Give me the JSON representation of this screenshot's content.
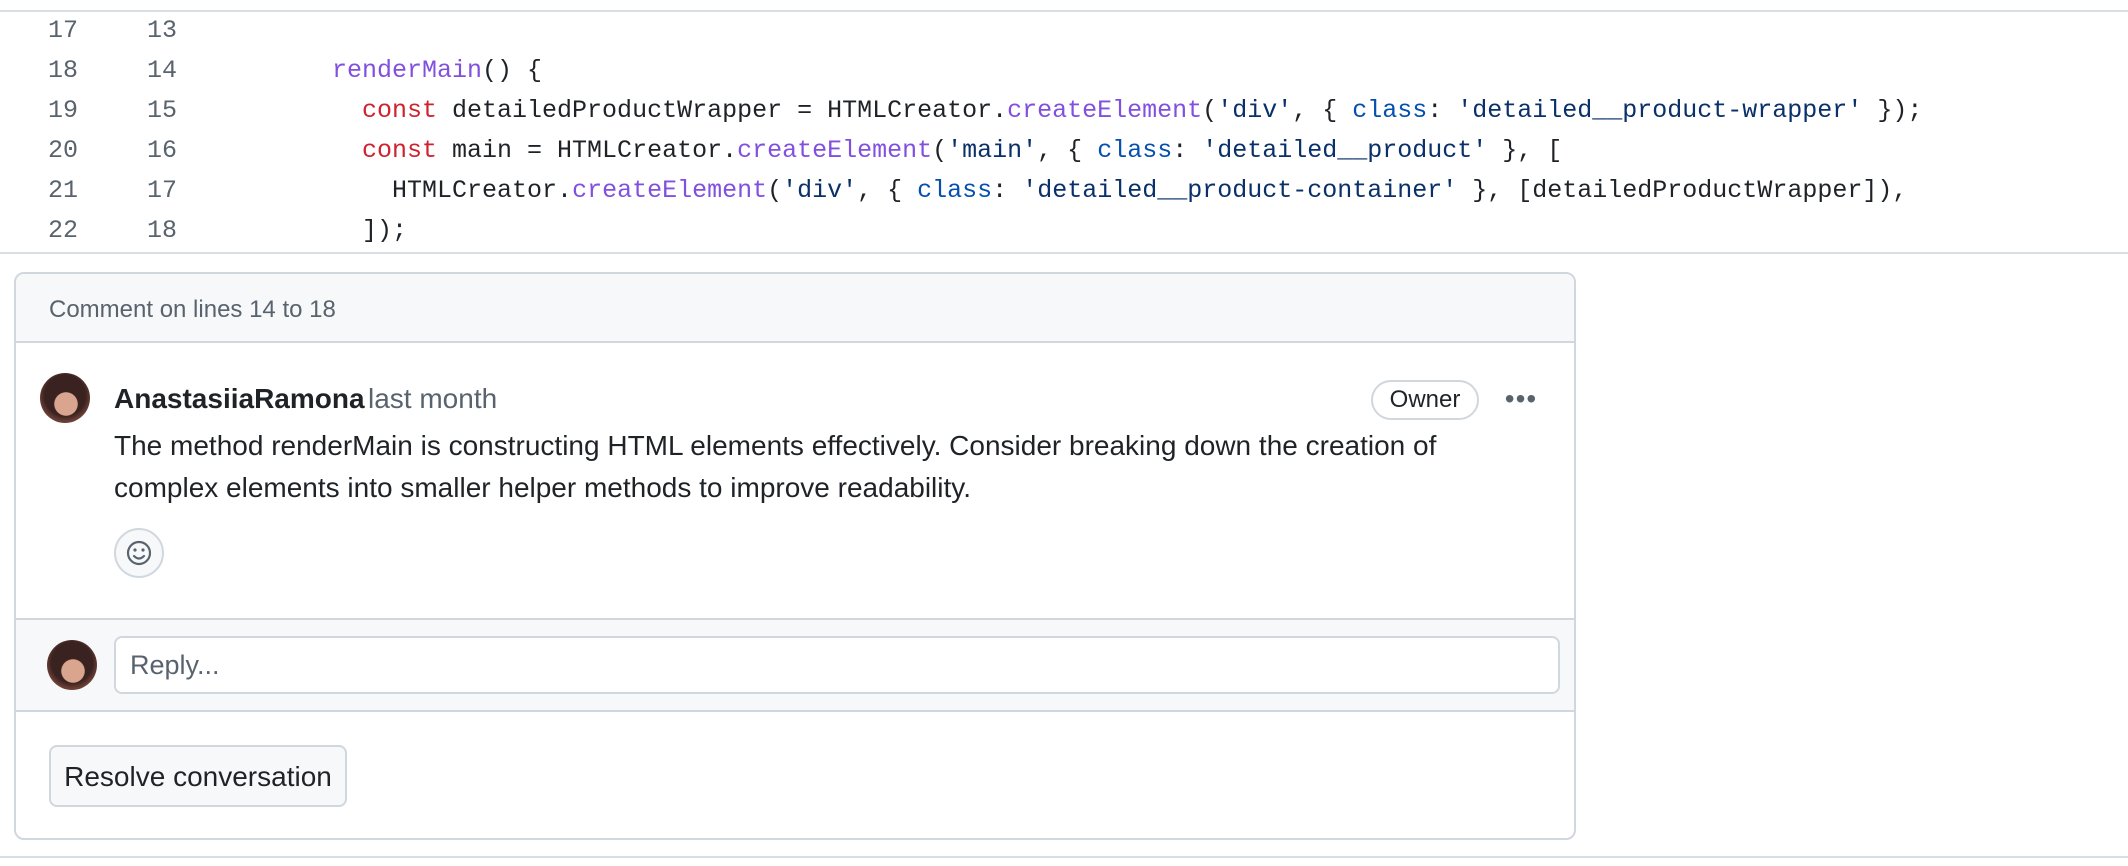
{
  "code": {
    "lines": [
      {
        "old": "17",
        "new": "13",
        "segments": []
      },
      {
        "old": "18",
        "new": "14",
        "segments": [
          {
            "t": "    ",
            "c": ""
          },
          {
            "t": "renderMain",
            "c": "f"
          },
          {
            "t": "() {",
            "c": ""
          }
        ]
      },
      {
        "old": "19",
        "new": "15",
        "segments": [
          {
            "t": "      ",
            "c": ""
          },
          {
            "t": "const",
            "c": "k"
          },
          {
            "t": " detailedProductWrapper = HTMLCreator.",
            "c": ""
          },
          {
            "t": "createElement",
            "c": "f"
          },
          {
            "t": "(",
            "c": ""
          },
          {
            "t": "'div'",
            "c": "s"
          },
          {
            "t": ", { ",
            "c": ""
          },
          {
            "t": "class",
            "c": "p"
          },
          {
            "t": ": ",
            "c": ""
          },
          {
            "t": "'detailed__product-wrapper'",
            "c": "s"
          },
          {
            "t": " });",
            "c": ""
          }
        ]
      },
      {
        "old": "20",
        "new": "16",
        "segments": [
          {
            "t": "      ",
            "c": ""
          },
          {
            "t": "const",
            "c": "k"
          },
          {
            "t": " main = HTMLCreator.",
            "c": ""
          },
          {
            "t": "createElement",
            "c": "f"
          },
          {
            "t": "(",
            "c": ""
          },
          {
            "t": "'main'",
            "c": "s"
          },
          {
            "t": ", { ",
            "c": ""
          },
          {
            "t": "class",
            "c": "p"
          },
          {
            "t": ": ",
            "c": ""
          },
          {
            "t": "'detailed__product'",
            "c": "s"
          },
          {
            "t": " }, [",
            "c": ""
          }
        ]
      },
      {
        "old": "21",
        "new": "17",
        "segments": [
          {
            "t": "        HTMLCreator.",
            "c": ""
          },
          {
            "t": "createElement",
            "c": "f"
          },
          {
            "t": "(",
            "c": ""
          },
          {
            "t": "'div'",
            "c": "s"
          },
          {
            "t": ", { ",
            "c": ""
          },
          {
            "t": "class",
            "c": "p"
          },
          {
            "t": ": ",
            "c": ""
          },
          {
            "t": "'detailed__product-container'",
            "c": "s"
          },
          {
            "t": " }, [detailedProductWrapper]),",
            "c": ""
          }
        ]
      },
      {
        "old": "22",
        "new": "18",
        "segments": [
          {
            "t": "      ]);",
            "c": ""
          }
        ]
      }
    ]
  },
  "thread": {
    "title": "Comment on lines 14 to 18",
    "comment": {
      "author": "AnastasiiaRamona",
      "time": "last month",
      "badge": "Owner",
      "more_icon": "kebab-horizontal-icon",
      "avatar_icon": "user-avatar",
      "body": "The method renderMain is constructing HTML elements effectively. Consider breaking down the creation of complex elements into smaller helper methods to improve readability.",
      "reaction_icon": "smiley-icon"
    },
    "reply": {
      "placeholder": "Reply..."
    },
    "resolve_label": "Resolve conversation"
  },
  "colors": {
    "keyword": "#cf222e",
    "function": "#8250df",
    "string": "#0a3069",
    "property": "#0550ae",
    "border": "#d0d7de",
    "muted_text": "#59636e"
  }
}
